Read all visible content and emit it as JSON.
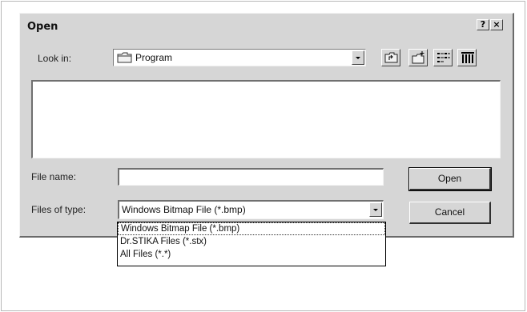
{
  "dialog": {
    "title": "Open",
    "help_button": "?",
    "close_button": "×"
  },
  "look_in": {
    "label": "Look in:",
    "value": "Program",
    "icon": "folder-icon"
  },
  "toolbar": {
    "up_one_level_icon": "up-folder-icon",
    "create_new_folder_icon": "new-folder-icon",
    "list_view_icon": "list-view-icon",
    "details_view_icon": "details-view-icon"
  },
  "file_name": {
    "label": "File name:",
    "value": ""
  },
  "files_of_type": {
    "label": "Files of type:",
    "value": "Windows Bitmap File (*.bmp)",
    "options": [
      "Windows Bitmap File (*.bmp)",
      "Dr.STIKA Files (*.stx)",
      "All Files (*.*)"
    ]
  },
  "buttons": {
    "open": "Open",
    "cancel": "Cancel"
  }
}
